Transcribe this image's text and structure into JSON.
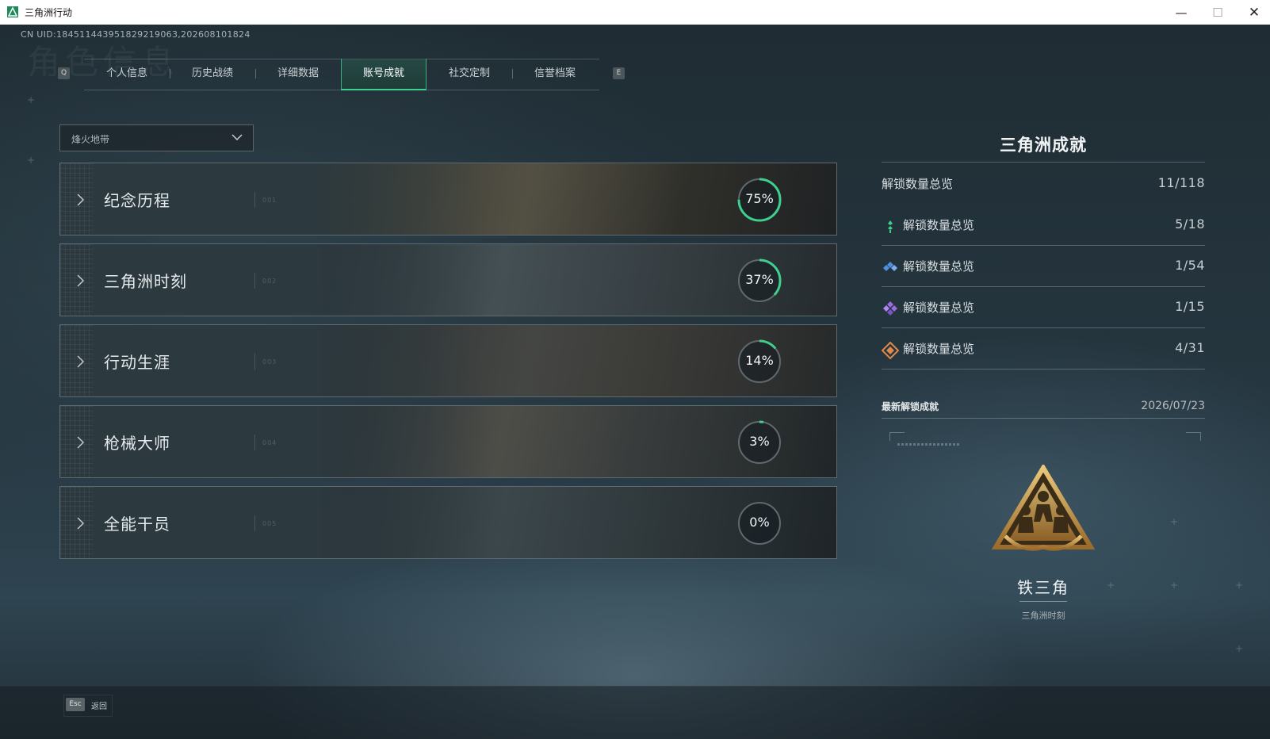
{
  "window": {
    "title": "三角洲行动",
    "minimize": "—",
    "maximize": "☐",
    "close": "✕"
  },
  "uid_line": "CN UID:184511443951829219063,202608101824",
  "ghost_title": "角色信息",
  "tabs": {
    "key_prev": "Q",
    "key_next": "E",
    "items": [
      {
        "label": "个人信息"
      },
      {
        "label": "历史战绩"
      },
      {
        "label": "详细数据"
      },
      {
        "label": "账号成就",
        "active": true
      },
      {
        "label": "社交定制"
      },
      {
        "label": "信誉档案"
      }
    ]
  },
  "mode_select": {
    "value": "烽火地带",
    "icon": "chevron-down-icon"
  },
  "categories": [
    {
      "name": "纪念历程",
      "percent": 75,
      "percent_label": "75%",
      "deco": "001"
    },
    {
      "name": "三角洲时刻",
      "percent": 37,
      "percent_label": "37%",
      "deco": "002"
    },
    {
      "name": "行动生涯",
      "percent": 14,
      "percent_label": "14%",
      "deco": "003"
    },
    {
      "name": "枪械大师",
      "percent": 3,
      "percent_label": "3%",
      "deco": "004"
    },
    {
      "name": "全能干员",
      "percent": 0,
      "percent_label": "0%",
      "deco": "005"
    }
  ],
  "achievements": {
    "title": "三角洲成就",
    "total": {
      "label": "解锁数量总览",
      "value": "11/118"
    },
    "tiers": [
      {
        "label": "解锁数量总览",
        "value": "5/18",
        "color": "#3fce8a",
        "icon": "green-tier-icon"
      },
      {
        "label": "解锁数量总览",
        "value": "1/54",
        "color": "#4f8fe0",
        "icon": "blue-tier-icon"
      },
      {
        "label": "解锁数量总览",
        "value": "1/15",
        "color": "#9b6be0",
        "icon": "purple-tier-icon"
      },
      {
        "label": "解锁数量总览",
        "value": "4/31",
        "color": "#e0874a",
        "icon": "orange-tier-icon"
      }
    ],
    "latest": {
      "label": "最新解锁成就",
      "date": "2026/07/23",
      "badge_name": "铁三角",
      "badge_category": "三角洲时刻",
      "badge_icon": "gold-triangle-badge-icon"
    }
  },
  "footer": {
    "esc_key": "Esc",
    "back_label": "返回"
  },
  "colors": {
    "accent": "#3fd08f",
    "ring_track": "#5f6a6f",
    "ring_fill": "#3fd08f"
  }
}
